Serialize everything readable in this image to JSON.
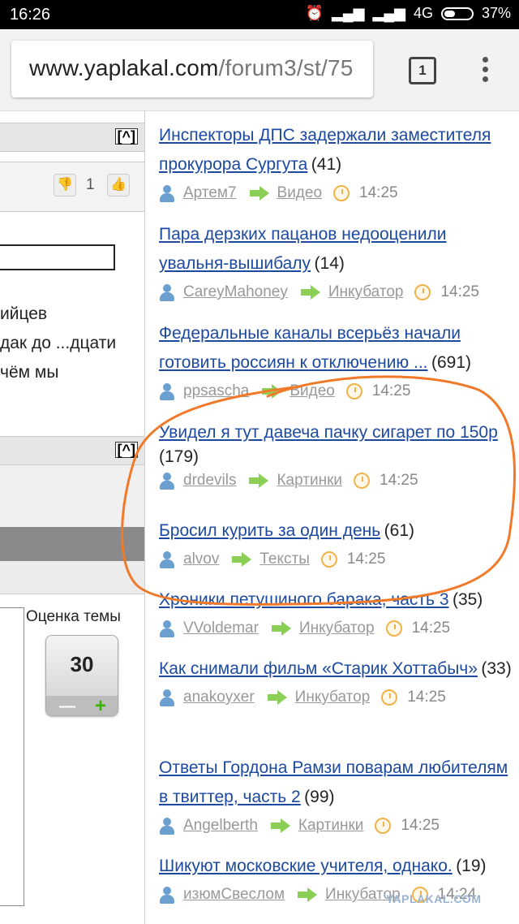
{
  "status_bar": {
    "time": "16:26",
    "network": "4G",
    "battery": "37%"
  },
  "browser": {
    "url_domain": "www.yaplakal.com",
    "url_path": "/forum3/st/75",
    "tabs_count": "1"
  },
  "left": {
    "vote_count": "1",
    "text_lines": [
      "ийцев",
      "дак до ...дцати",
      "чём мы"
    ],
    "scroll_up_label": "[^]",
    "rating_label": "Оценка темы",
    "rating_value": "30"
  },
  "news": [
    {
      "title": "Инспекторы ДПС задержали заместителя прокурора Сургута",
      "count": "(41)",
      "user": "Артем7",
      "section": "Видео",
      "time": "14:25"
    },
    {
      "title": "Пара дерзких пацанов недооценили увальня-вышибалу",
      "count": "(14)",
      "user": "CareyMahoney",
      "section": "Инкубатор",
      "time": "14:25"
    },
    {
      "title": "Федеральные каналы всерьёз начали готовить россиян к отключению ...",
      "count": "(691)",
      "user": "ppsascha",
      "section": "Видео",
      "time": "14:25"
    },
    {
      "title": "Увидел я тут давеча пачку сигарет по 150р",
      "count": "(179)",
      "user": "drdevils",
      "section": "Картинки",
      "time": "14:25"
    },
    {
      "title": "Бросил курить за один день",
      "count": "(61)",
      "user": "alvov",
      "section": "Тексты",
      "time": "14:25"
    },
    {
      "title": "Хроники петушиного барака, часть 3",
      "count": "(35)",
      "user": "VVoldemar",
      "section": "Инкубатор",
      "time": "14:25"
    },
    {
      "title": "Как снимали фильм «Старик Хоттабыч»",
      "count": "(33)",
      "user": "anakoyxer",
      "section": "Инкубатор",
      "time": "14:25"
    },
    {
      "title": "Ответы Гордона Рамзи поварам любителям в твиттер, часть 2",
      "count": "(99)",
      "user": "Angelberth",
      "section": "Картинки",
      "time": "14:25"
    },
    {
      "title": "Шикуют московские учителя, однако.",
      "count": "(19)",
      "user": "изюмСвеслом",
      "section": "Инкубатор",
      "time": "14:24"
    }
  ],
  "watermark": "YAPLAKAL.COM",
  "colors": {
    "link": "#1d4aa0",
    "annotation": "#f07a2a",
    "arrow": "#8ccf57",
    "user_icon": "#6a9fd0",
    "clock": "#f0b24a"
  }
}
